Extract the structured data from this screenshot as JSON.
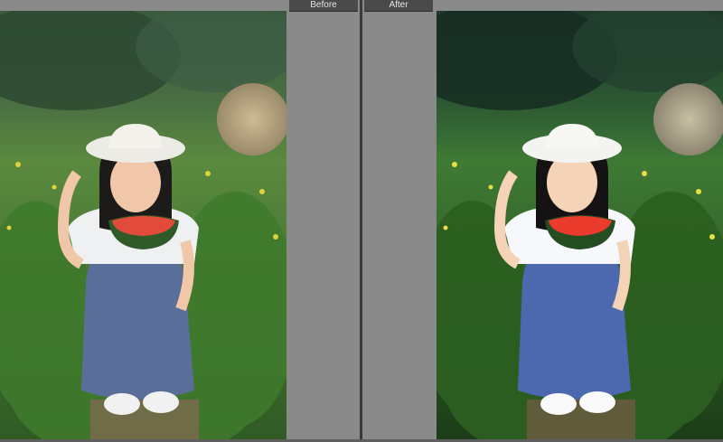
{
  "comparison": {
    "before_label": "Before",
    "after_label": "After"
  },
  "icons": {
    "before_photo": "photo-icon",
    "after_photo": "photo-icon"
  },
  "colors": {
    "canvas_gray": "#8a8a8a",
    "label_tab_bg": "#4a4a4a",
    "label_text": "#e6e6e6",
    "divider": "#3a3a3a"
  }
}
